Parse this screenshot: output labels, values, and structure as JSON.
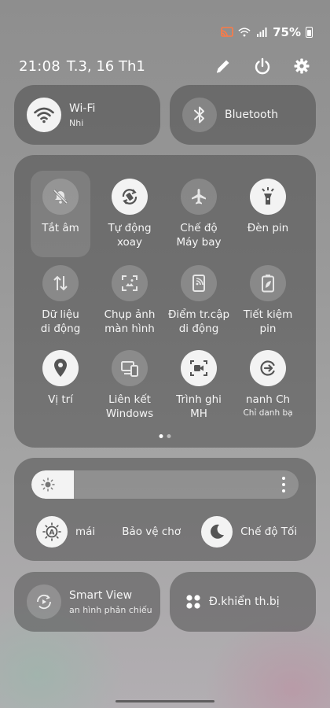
{
  "status": {
    "battery_percent": "75%"
  },
  "header": {
    "time": "21:08",
    "date": "T.3, 16 Th1"
  },
  "top_pills": [
    {
      "title": "Wi-Fi",
      "subtitle": "Nhi",
      "active": true,
      "icon": "wifi-icon"
    },
    {
      "title": "Bluetooth",
      "active": false,
      "icon": "bluetooth-icon"
    }
  ],
  "tiles": [
    {
      "label": "Tắt âm",
      "icon": "mute-icon",
      "active": false
    },
    {
      "label": "Tự động\nxoay",
      "icon": "auto-rotate-icon",
      "active": true
    },
    {
      "label": "Chế độ\nMáy bay",
      "icon": "airplane-icon",
      "active": false
    },
    {
      "label": "Đèn pin",
      "icon": "flashlight-icon",
      "active": true
    },
    {
      "label": "Dữ liệu\ndi động",
      "icon": "mobile-data-icon",
      "active": false
    },
    {
      "label": "Chụp ảnh\nmàn hình",
      "icon": "screenshot-icon",
      "active": false
    },
    {
      "label": "Điểm tr.cập\ndi động",
      "icon": "hotspot-icon",
      "active": false
    },
    {
      "label": "Tiết kiệm\npin",
      "icon": "battery-saver-icon",
      "active": false
    },
    {
      "label": "Vị trí",
      "icon": "location-icon",
      "active": true
    },
    {
      "label": "Liên kết\nWindows",
      "icon": "link-windows-icon",
      "active": false
    },
    {
      "label": "Trình ghi\nMH",
      "icon": "screen-recorder-icon",
      "active": true
    },
    {
      "label": "nanh       Ch",
      "sublabel": "Chỉ danh bạ",
      "icon": "quick-share-icon",
      "active": true
    }
  ],
  "pager": {
    "pages": 2,
    "current": 1
  },
  "brightness": {
    "level": 0.16,
    "adaptive_label": "mái",
    "eye_comfort_label": "Bảo vệ chơ",
    "dark_mode_label": "Chế độ Tối"
  },
  "bottom_pills": [
    {
      "title": "Smart View",
      "subtitle": "an hình phản chiếu",
      "icon": "smart-view-icon"
    },
    {
      "title": "Đ.khiển th.bị",
      "icon": "device-control-icon"
    }
  ]
}
